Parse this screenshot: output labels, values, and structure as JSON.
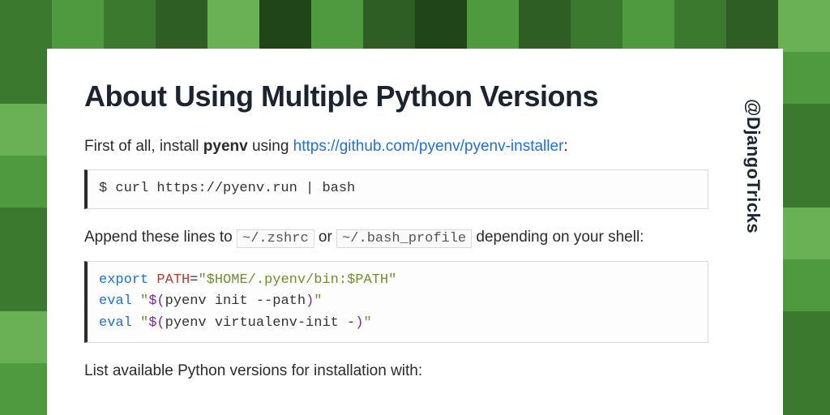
{
  "handle": "@DjangoTricks",
  "title": "About Using Multiple Python Versions",
  "intro": {
    "prefix": "First of all, install ",
    "bold": "pyenv",
    "mid": " using ",
    "link_text": "https://github.com/pyenv/pyenv-installer",
    "suffix": ":"
  },
  "cmd_install": "$ curl https://pyenv.run | bash",
  "append": {
    "p1": "Append these lines to ",
    "file1": "~/.zshrc",
    "or": " or ",
    "file2": "~/.bash_profile",
    "p2": " depending on your shell:"
  },
  "shellrc": {
    "l1_kw": "export",
    "l1_var": " PATH",
    "l1_eq": "=",
    "l1_str": "\"$HOME/.pyenv/bin:$PATH\"",
    "l2_kw": "eval",
    "l2_sp": " ",
    "l2_q1": "\"",
    "l2_op": "$(",
    "l2_body": "pyenv init --path",
    "l2_cp": ")",
    "l2_q2": "\"",
    "l3_kw": "eval",
    "l3_sp": " ",
    "l3_q1": "\"",
    "l3_op": "$(",
    "l3_body": "pyenv virtualenv-init -",
    "l3_cp": ")",
    "l3_q2": "\""
  },
  "list_line": "List available Python versions for installation with:"
}
